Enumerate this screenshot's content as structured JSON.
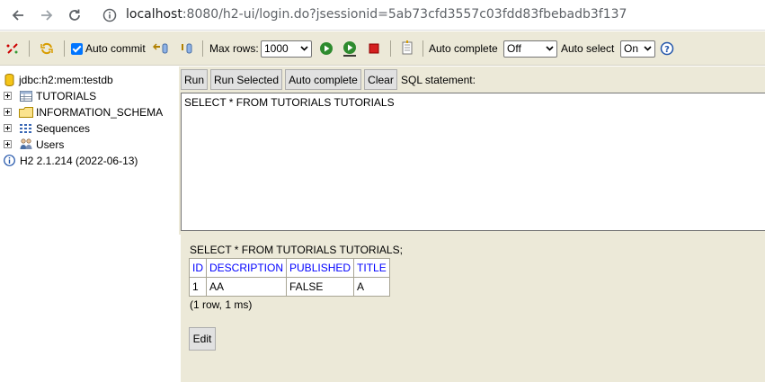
{
  "browser": {
    "url_host": "localhost",
    "url_rest": ":8080/h2-ui/login.do?jsessionid=5ab73cfd3557c03fdd83fbebadb3f137"
  },
  "toolbar": {
    "auto_commit_label": "Auto commit",
    "auto_commit_checked": true,
    "max_rows_label": "Max rows:",
    "max_rows_value": "1000",
    "auto_complete_label": "Auto complete",
    "auto_complete_value": "Off",
    "auto_select_label": "Auto select",
    "auto_select_value": "On"
  },
  "tree": {
    "connection": "jdbc:h2:mem:testdb",
    "items": [
      {
        "label": "TUTORIALS",
        "icon": "table-icon"
      },
      {
        "label": "INFORMATION_SCHEMA",
        "icon": "folder-icon"
      },
      {
        "label": "Sequences",
        "icon": "sequences-icon"
      },
      {
        "label": "Users",
        "icon": "users-icon"
      }
    ],
    "version": "H2 2.1.214 (2022-06-13)"
  },
  "query": {
    "run_label": "Run",
    "run_selected_label": "Run Selected",
    "auto_complete_label": "Auto complete",
    "clear_label": "Clear",
    "sql_statement_label": "SQL statement:",
    "sql_text": "SELECT * FROM TUTORIALS TUTORIALS"
  },
  "result": {
    "sql_echo": "SELECT * FROM TUTORIALS TUTORIALS;",
    "columns": [
      "ID",
      "DESCRIPTION",
      "PUBLISHED",
      "TITLE"
    ],
    "rows": [
      [
        "1",
        "AA",
        "FALSE",
        "A"
      ]
    ],
    "summary": "(1 row, 1 ms)",
    "edit_label": "Edit"
  }
}
